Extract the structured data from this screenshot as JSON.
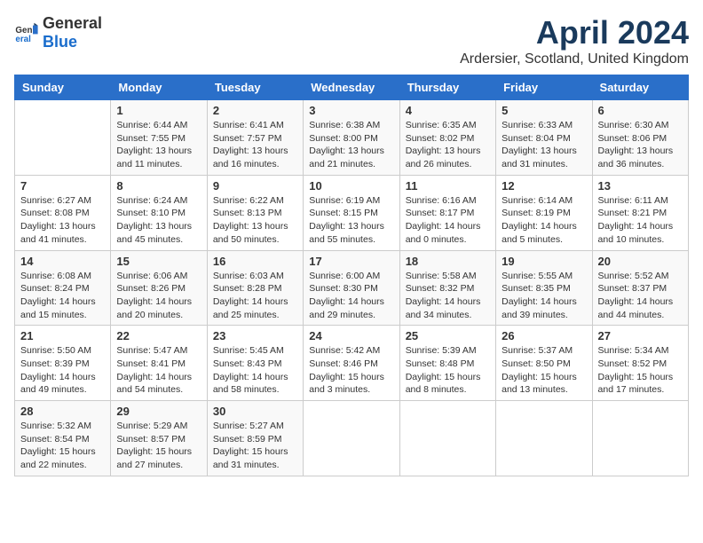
{
  "header": {
    "logo_general": "General",
    "logo_blue": "Blue",
    "month_title": "April 2024",
    "location": "Ardersier, Scotland, United Kingdom"
  },
  "days_of_week": [
    "Sunday",
    "Monday",
    "Tuesday",
    "Wednesday",
    "Thursday",
    "Friday",
    "Saturday"
  ],
  "weeks": [
    [
      {
        "day": "",
        "info": ""
      },
      {
        "day": "1",
        "info": "Sunrise: 6:44 AM\nSunset: 7:55 PM\nDaylight: 13 hours\nand 11 minutes."
      },
      {
        "day": "2",
        "info": "Sunrise: 6:41 AM\nSunset: 7:57 PM\nDaylight: 13 hours\nand 16 minutes."
      },
      {
        "day": "3",
        "info": "Sunrise: 6:38 AM\nSunset: 8:00 PM\nDaylight: 13 hours\nand 21 minutes."
      },
      {
        "day": "4",
        "info": "Sunrise: 6:35 AM\nSunset: 8:02 PM\nDaylight: 13 hours\nand 26 minutes."
      },
      {
        "day": "5",
        "info": "Sunrise: 6:33 AM\nSunset: 8:04 PM\nDaylight: 13 hours\nand 31 minutes."
      },
      {
        "day": "6",
        "info": "Sunrise: 6:30 AM\nSunset: 8:06 PM\nDaylight: 13 hours\nand 36 minutes."
      }
    ],
    [
      {
        "day": "7",
        "info": "Sunrise: 6:27 AM\nSunset: 8:08 PM\nDaylight: 13 hours\nand 41 minutes."
      },
      {
        "day": "8",
        "info": "Sunrise: 6:24 AM\nSunset: 8:10 PM\nDaylight: 13 hours\nand 45 minutes."
      },
      {
        "day": "9",
        "info": "Sunrise: 6:22 AM\nSunset: 8:13 PM\nDaylight: 13 hours\nand 50 minutes."
      },
      {
        "day": "10",
        "info": "Sunrise: 6:19 AM\nSunset: 8:15 PM\nDaylight: 13 hours\nand 55 minutes."
      },
      {
        "day": "11",
        "info": "Sunrise: 6:16 AM\nSunset: 8:17 PM\nDaylight: 14 hours\nand 0 minutes."
      },
      {
        "day": "12",
        "info": "Sunrise: 6:14 AM\nSunset: 8:19 PM\nDaylight: 14 hours\nand 5 minutes."
      },
      {
        "day": "13",
        "info": "Sunrise: 6:11 AM\nSunset: 8:21 PM\nDaylight: 14 hours\nand 10 minutes."
      }
    ],
    [
      {
        "day": "14",
        "info": "Sunrise: 6:08 AM\nSunset: 8:24 PM\nDaylight: 14 hours\nand 15 minutes."
      },
      {
        "day": "15",
        "info": "Sunrise: 6:06 AM\nSunset: 8:26 PM\nDaylight: 14 hours\nand 20 minutes."
      },
      {
        "day": "16",
        "info": "Sunrise: 6:03 AM\nSunset: 8:28 PM\nDaylight: 14 hours\nand 25 minutes."
      },
      {
        "day": "17",
        "info": "Sunrise: 6:00 AM\nSunset: 8:30 PM\nDaylight: 14 hours\nand 29 minutes."
      },
      {
        "day": "18",
        "info": "Sunrise: 5:58 AM\nSunset: 8:32 PM\nDaylight: 14 hours\nand 34 minutes."
      },
      {
        "day": "19",
        "info": "Sunrise: 5:55 AM\nSunset: 8:35 PM\nDaylight: 14 hours\nand 39 minutes."
      },
      {
        "day": "20",
        "info": "Sunrise: 5:52 AM\nSunset: 8:37 PM\nDaylight: 14 hours\nand 44 minutes."
      }
    ],
    [
      {
        "day": "21",
        "info": "Sunrise: 5:50 AM\nSunset: 8:39 PM\nDaylight: 14 hours\nand 49 minutes."
      },
      {
        "day": "22",
        "info": "Sunrise: 5:47 AM\nSunset: 8:41 PM\nDaylight: 14 hours\nand 54 minutes."
      },
      {
        "day": "23",
        "info": "Sunrise: 5:45 AM\nSunset: 8:43 PM\nDaylight: 14 hours\nand 58 minutes."
      },
      {
        "day": "24",
        "info": "Sunrise: 5:42 AM\nSunset: 8:46 PM\nDaylight: 15 hours\nand 3 minutes."
      },
      {
        "day": "25",
        "info": "Sunrise: 5:39 AM\nSunset: 8:48 PM\nDaylight: 15 hours\nand 8 minutes."
      },
      {
        "day": "26",
        "info": "Sunrise: 5:37 AM\nSunset: 8:50 PM\nDaylight: 15 hours\nand 13 minutes."
      },
      {
        "day": "27",
        "info": "Sunrise: 5:34 AM\nSunset: 8:52 PM\nDaylight: 15 hours\nand 17 minutes."
      }
    ],
    [
      {
        "day": "28",
        "info": "Sunrise: 5:32 AM\nSunset: 8:54 PM\nDaylight: 15 hours\nand 22 minutes."
      },
      {
        "day": "29",
        "info": "Sunrise: 5:29 AM\nSunset: 8:57 PM\nDaylight: 15 hours\nand 27 minutes."
      },
      {
        "day": "30",
        "info": "Sunrise: 5:27 AM\nSunset: 8:59 PM\nDaylight: 15 hours\nand 31 minutes."
      },
      {
        "day": "",
        "info": ""
      },
      {
        "day": "",
        "info": ""
      },
      {
        "day": "",
        "info": ""
      },
      {
        "day": "",
        "info": ""
      }
    ]
  ]
}
